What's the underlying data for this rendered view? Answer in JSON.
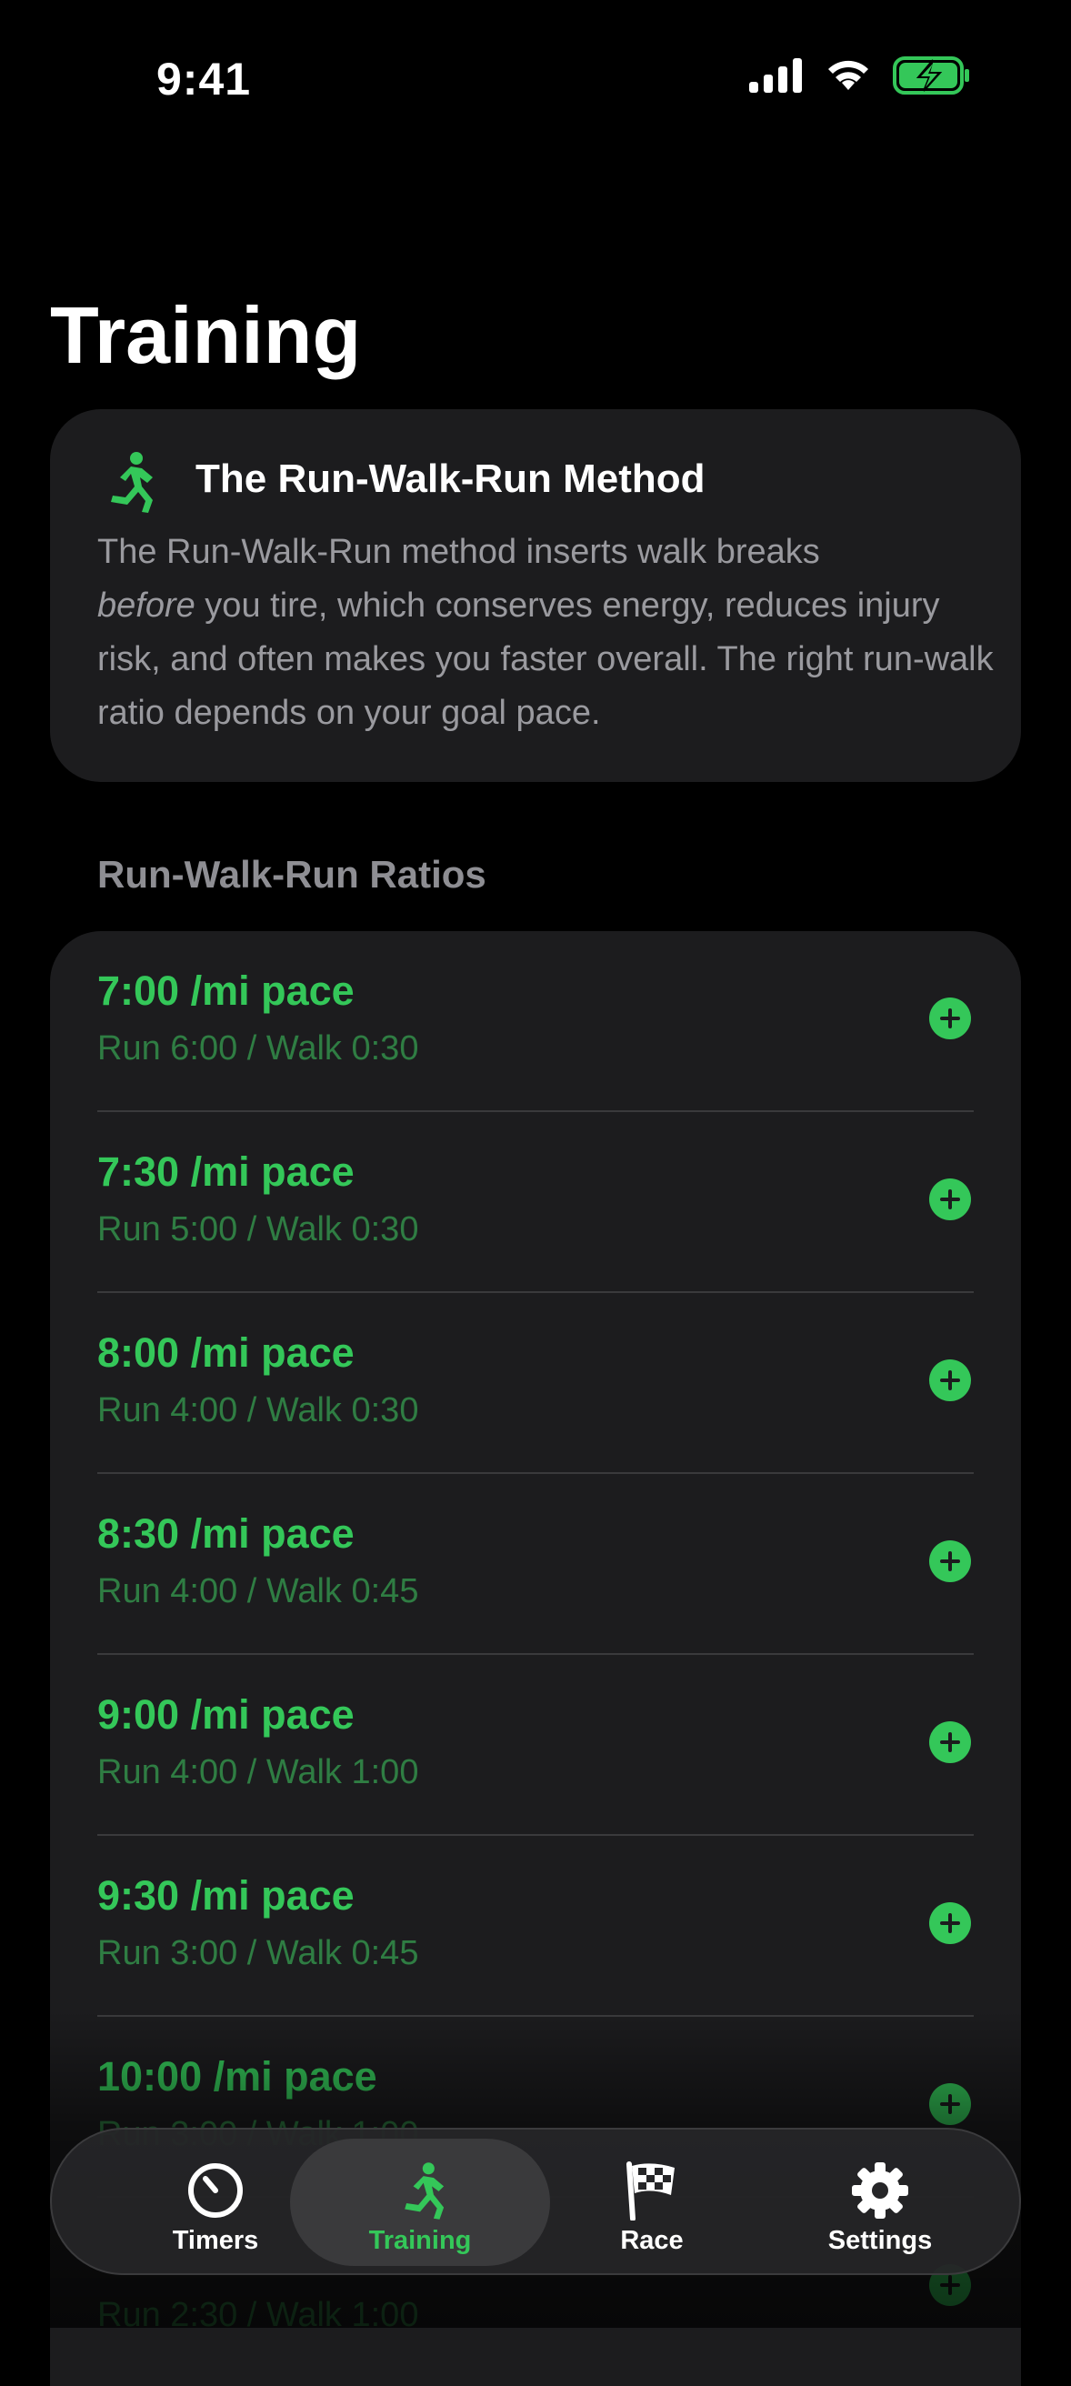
{
  "status_bar": {
    "time": "9:41",
    "icons": [
      "cellular-signal-icon",
      "wifi-icon",
      "battery-charging-icon"
    ]
  },
  "page": {
    "title": "Training"
  },
  "info_card": {
    "icon": "running-figure-icon",
    "title": "The Run-Walk-Run Method",
    "body_emphasis": "before",
    "body_line1": "The Run-Walk-Run method inserts walk breaks",
    "body_rest": " you tire, which conserves energy, reduces injury risk, and often makes you faster overall. The right run-walk ratio depends on your goal pace."
  },
  "ratios_section": {
    "header": "Run-Walk-Run Ratios",
    "items": [
      {
        "pace": "7:00 /mi pace",
        "detail": "Run 6:00 / Walk 0:30"
      },
      {
        "pace": "7:30 /mi pace",
        "detail": "Run 5:00 / Walk 0:30"
      },
      {
        "pace": "8:00 /mi pace",
        "detail": "Run 4:00 / Walk 0:30"
      },
      {
        "pace": "8:30 /mi pace",
        "detail": "Run 4:00 / Walk 0:45"
      },
      {
        "pace": "9:00 /mi pace",
        "detail": "Run 4:00 / Walk 1:00"
      },
      {
        "pace": "9:30 /mi pace",
        "detail": "Run 3:00 / Walk 0:45"
      },
      {
        "pace": "10:00 /mi pace",
        "detail": "Run 3:00 / Walk 1:00"
      },
      {
        "pace": "",
        "detail": "Run 2:30 / Walk 1:00"
      }
    ]
  },
  "tab_bar": {
    "tabs": [
      {
        "label": "Timers",
        "icon": "timer-icon",
        "active": false
      },
      {
        "label": "Training",
        "icon": "running-figure-icon",
        "active": true
      },
      {
        "label": "Race",
        "icon": "checkered-flag-icon",
        "active": false
      },
      {
        "label": "Settings",
        "icon": "gear-icon",
        "active": false
      }
    ]
  },
  "colors": {
    "accent": "#34c759",
    "detail_green": "#2f7d43",
    "card_bg": "#1c1c1e",
    "background": "#000000"
  }
}
